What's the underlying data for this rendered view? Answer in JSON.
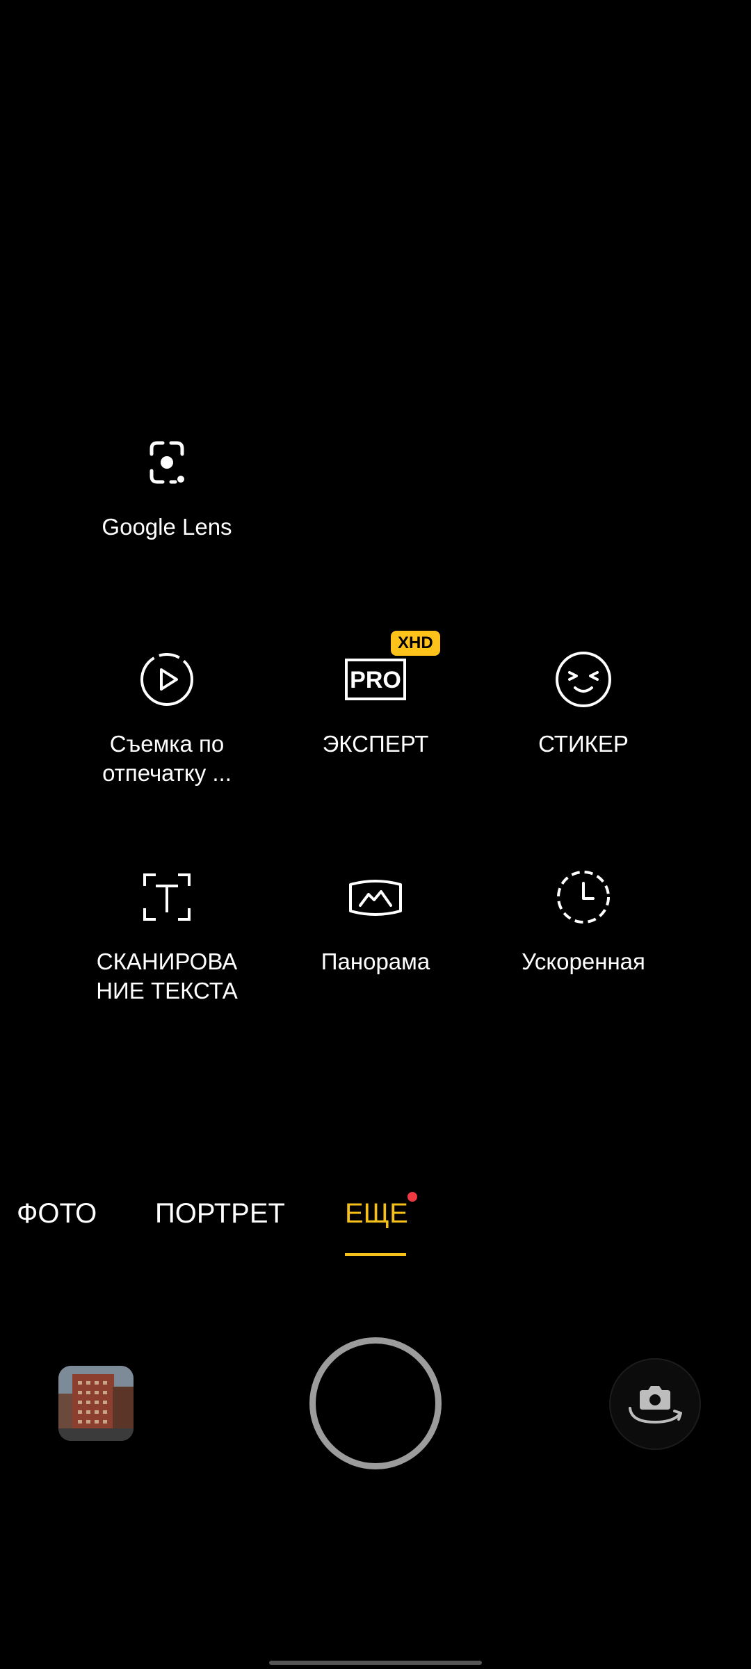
{
  "modes": {
    "google_lens": {
      "label": "Google Lens",
      "icon": "google-lens-icon"
    },
    "fingerprint": {
      "label": "Съемка по\nотпечатку ...",
      "icon": "fingerprint-play-icon"
    },
    "expert": {
      "label": "ЭКСПЕРТ",
      "icon": "pro-icon",
      "icon_text": "PRO",
      "badge": "XHD"
    },
    "sticker": {
      "label": "СТИКЕР",
      "icon": "sticker-face-icon"
    },
    "text_scan": {
      "label": "СКАНИРОВА\nНИЕ ТЕКСТА",
      "icon": "text-scan-icon"
    },
    "panorama": {
      "label": "Панорама",
      "icon": "panorama-icon"
    },
    "timelapse": {
      "label": "Ускоренная",
      "icon": "timelapse-icon"
    }
  },
  "tabs": {
    "photo": "ФОТО",
    "portrait": "ПОРТРЕТ",
    "more": "ЕЩЕ"
  },
  "colors": {
    "accent": "#f5c018",
    "badge": "#ffc21a",
    "new_dot": "#ef3a44",
    "background": "#000000"
  },
  "controls": {
    "gallery_icon": "gallery-thumbnail",
    "shutter_icon": "shutter-button",
    "switch_icon": "switch-camera-icon"
  }
}
